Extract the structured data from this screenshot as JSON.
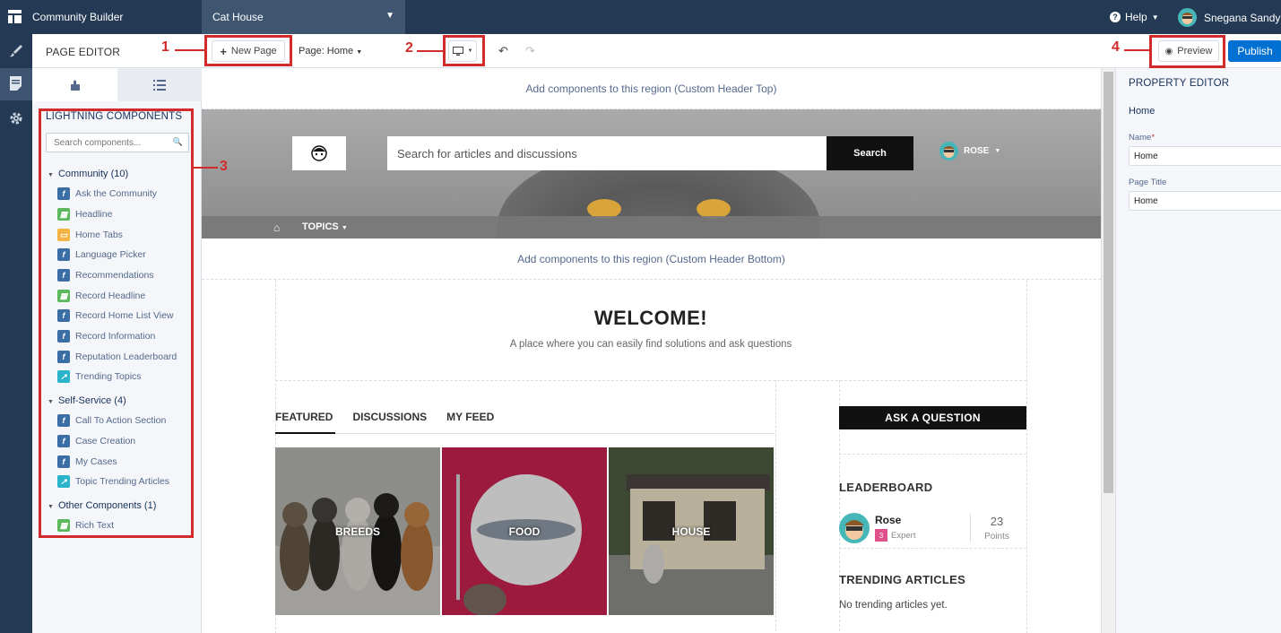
{
  "topbar": {
    "app_name": "Community Builder",
    "site_name": "Cat House",
    "help_label": "Help",
    "user_name": "Snegana Sandy"
  },
  "toolbar": {
    "title": "PAGE EDITOR",
    "new_page_label": "New Page",
    "page_selector": "Page: Home",
    "preview_label": "Preview",
    "publish_label": "Publish"
  },
  "callouts": [
    "1",
    "2",
    "3",
    "4"
  ],
  "left_panel": {
    "title": "LIGHTNING COMPONENTS",
    "search_placeholder": "Search components...",
    "groups": [
      {
        "label": "Community (10)",
        "items": [
          {
            "label": "Ask the Community",
            "icon": "lightning-icon"
          },
          {
            "label": "Headline",
            "icon": "table-icon"
          },
          {
            "label": "Home Tabs",
            "icon": "tabs-icon"
          },
          {
            "label": "Language Picker",
            "icon": "lightning-icon"
          },
          {
            "label": "Recommendations",
            "icon": "lightning-icon"
          },
          {
            "label": "Record Headline",
            "icon": "table-icon"
          },
          {
            "label": "Record Home List View",
            "icon": "lightning-icon"
          },
          {
            "label": "Record Information",
            "icon": "lightning-icon"
          },
          {
            "label": "Reputation Leaderboard",
            "icon": "lightning-icon"
          },
          {
            "label": "Trending Topics",
            "icon": "trend-icon"
          }
        ]
      },
      {
        "label": "Self-Service (4)",
        "items": [
          {
            "label": "Call To Action Section",
            "icon": "lightning-icon"
          },
          {
            "label": "Case Creation",
            "icon": "lightning-icon"
          },
          {
            "label": "My Cases",
            "icon": "lightning-icon"
          },
          {
            "label": "Topic Trending Articles",
            "icon": "trend-icon"
          }
        ]
      },
      {
        "label": "Other Components (1)",
        "items": [
          {
            "label": "Rich Text",
            "icon": "table-icon"
          }
        ]
      }
    ]
  },
  "canvas": {
    "region_top": "Add components to this region (Custom Header Top)",
    "region_bottom": "Add components to this region (Custom Header Bottom)",
    "site_search_placeholder": "Search for articles and discussions",
    "site_search_button": "Search",
    "site_user": "ROSE",
    "nav_topics": "TOPICS",
    "welcome_title": "WELCOME!",
    "welcome_sub": "A place where you can easily find solutions and ask questions",
    "feed_tabs": [
      "FEATURED",
      "DISCUSSIONS",
      "MY FEED"
    ],
    "tiles": [
      "BREEDS",
      "FOOD",
      "HOUSE"
    ],
    "ask_button": "ASK A QUESTION",
    "leaderboard_title": "LEADERBOARD",
    "leader": {
      "name": "Rose",
      "level": "3",
      "rank": "Expert",
      "points": "23",
      "points_label": "Points"
    },
    "trending_title": "TRENDING ARTICLES",
    "trending_empty": "No trending articles yet."
  },
  "property_editor": {
    "title": "PROPERTY EDITOR",
    "subtitle": "Home",
    "name_label": "Name",
    "name_value": "Home",
    "page_title_label": "Page Title",
    "page_title_value": "Home"
  },
  "colors": {
    "topbar": "#243a54",
    "callout": "#d22b2b",
    "publish": "#0070d2"
  }
}
